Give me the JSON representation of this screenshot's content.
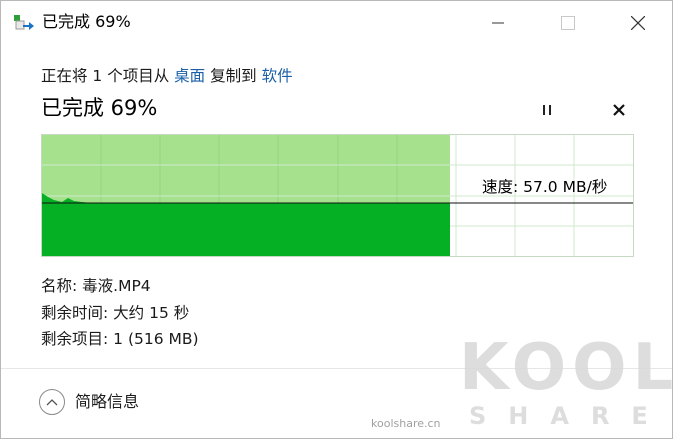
{
  "window": {
    "title": "已完成 69%",
    "icon": "copy-files-icon"
  },
  "header": {
    "desc_prefix": "正在将 1 个项目从",
    "source": "桌面",
    "desc_middle": "复制到",
    "destination": "软件"
  },
  "progress": {
    "title": "已完成 69%",
    "percent": 69,
    "pause_icon": "pause-icon",
    "stop_icon": "close-icon"
  },
  "graph": {
    "speed_label": "速度: 57.0 MB/秒",
    "fill_color": "#06b025",
    "remaining_color": "#ffffff",
    "completed_bg_color": "#a6e28e"
  },
  "details": {
    "name": "名称: 毒液.MP4",
    "time_remaining": "剩余时间: 大约 15 秒",
    "items_remaining": "剩余项目: 1 (516 MB)"
  },
  "footer": {
    "fewer_details": "简略信息",
    "icon": "chevron-up-icon"
  },
  "watermark": {
    "brand": "KOOL",
    "sub": "SHARE",
    "site": "koolshare.cn"
  }
}
